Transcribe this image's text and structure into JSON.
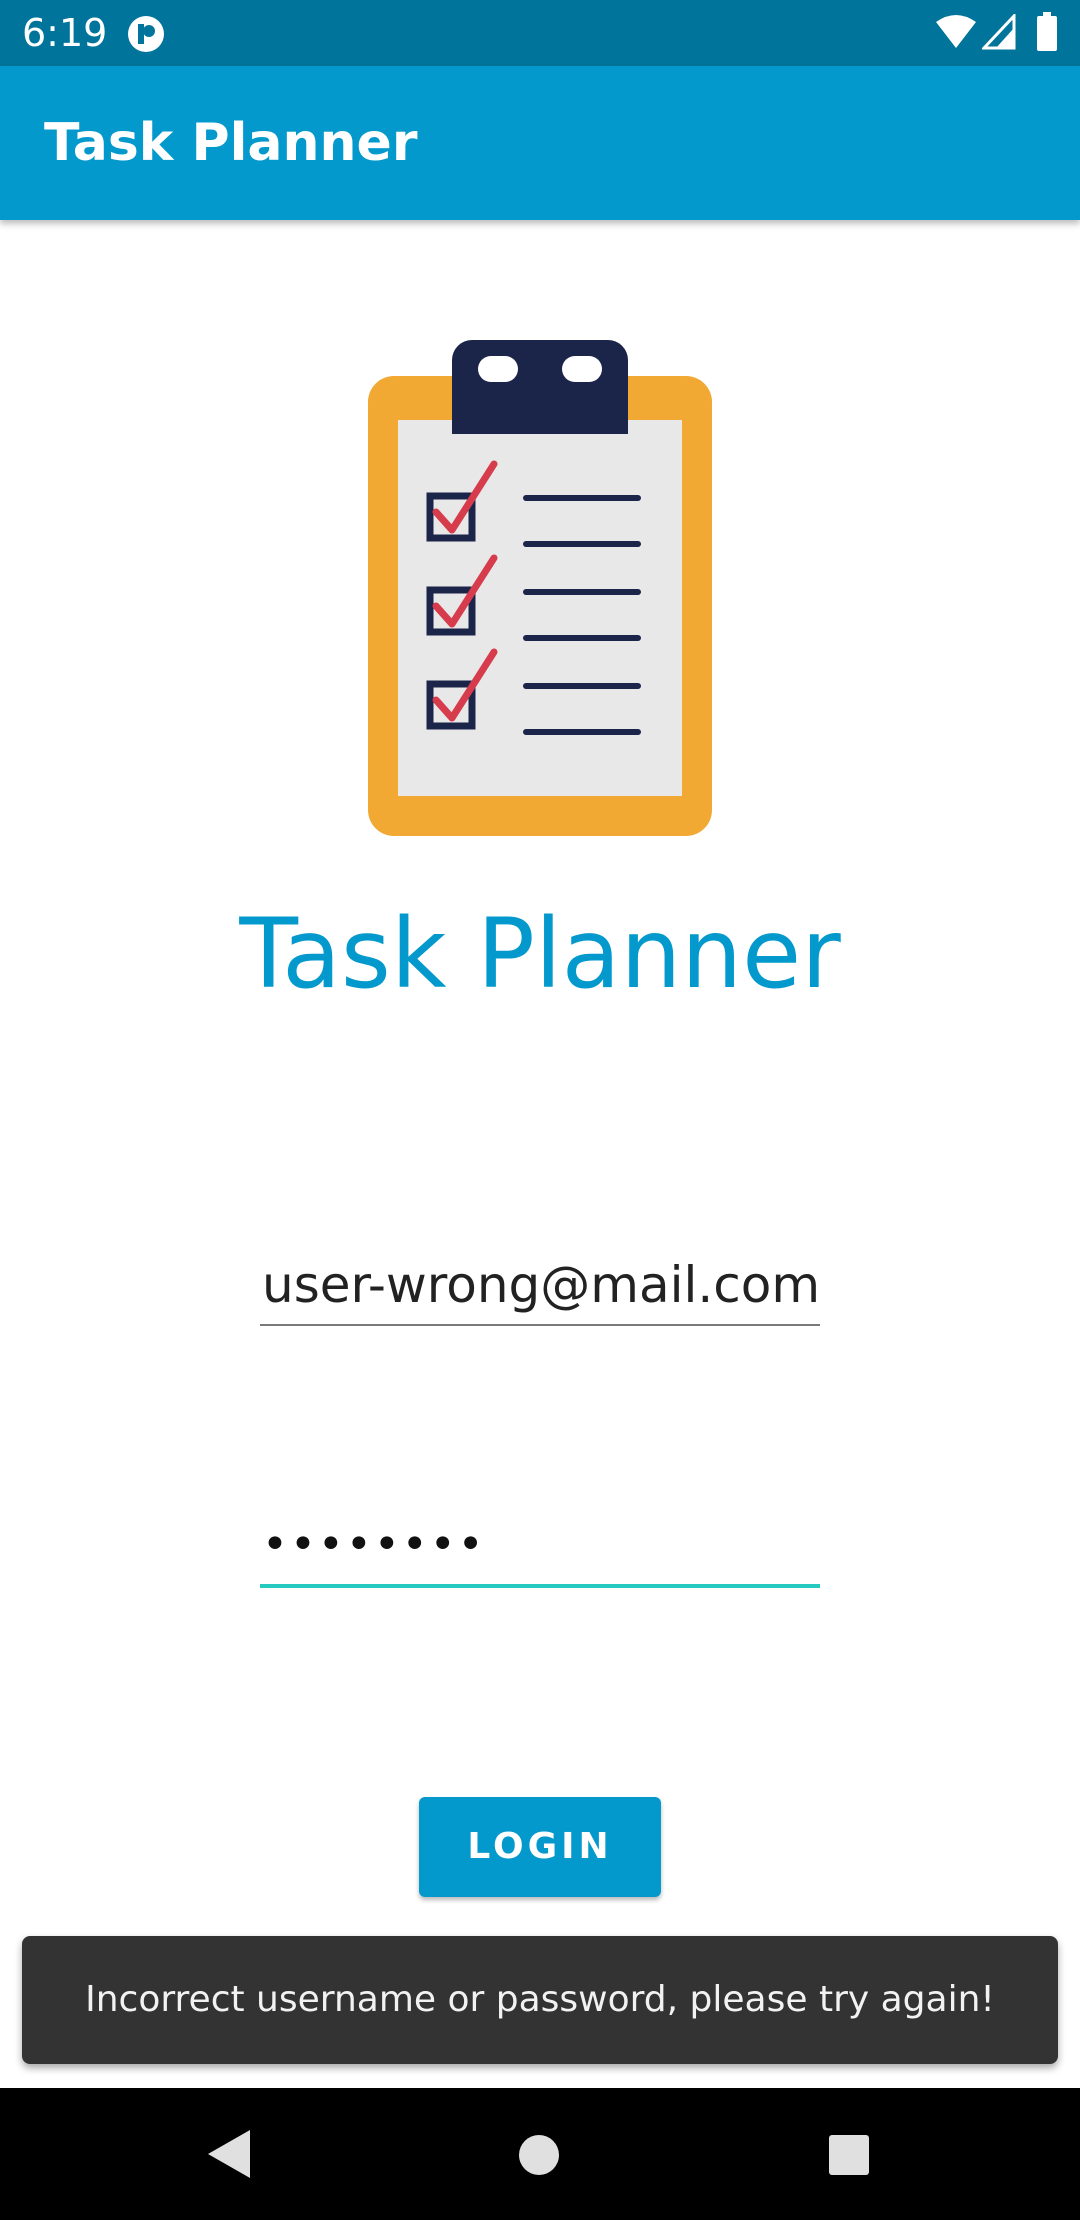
{
  "status_bar": {
    "time": "6:19",
    "icons": [
      "app-notification-icon",
      "wifi-icon",
      "signal-icon",
      "battery-icon"
    ]
  },
  "app_bar": {
    "title": "Task Planner"
  },
  "logo": {
    "icon": "clipboard-checklist-icon",
    "colors": {
      "board": "#f2a933",
      "paper": "#e8e8e8",
      "clip": "#1b2549",
      "check": "#d63c4c"
    }
  },
  "brand": {
    "title": "Task Planner"
  },
  "form": {
    "email_value": "user-wrong@mail.com",
    "password_masked": "••••••••",
    "login_label": "LOGIN"
  },
  "snackbar": {
    "message": "Incorrect username or password, please try again!"
  },
  "nav_bar": {
    "icons": [
      "back-icon",
      "home-icon",
      "recents-icon"
    ]
  },
  "colors": {
    "primary": "#0399cc",
    "status_bar": "#00749a",
    "focus_accent": "#26c9c0",
    "snackbar_bg": "#333333"
  }
}
